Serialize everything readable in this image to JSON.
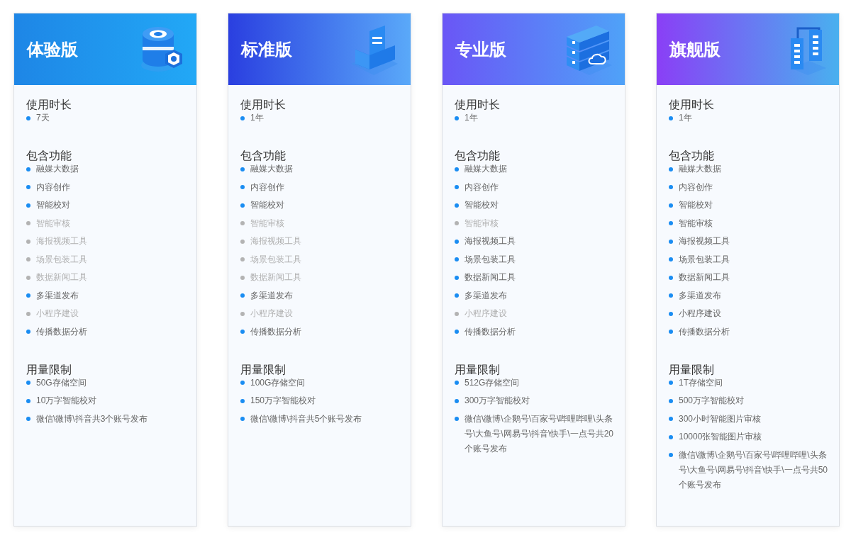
{
  "plans": [
    {
      "title": "体验版",
      "sections": [
        {
          "title": "使用时长",
          "items": [
            {
              "text": "7天",
              "included": true
            }
          ]
        },
        {
          "title": "包含功能",
          "items": [
            {
              "text": "融媒大数据",
              "included": true
            },
            {
              "text": "内容创作",
              "included": true
            },
            {
              "text": "智能校对",
              "included": true
            },
            {
              "text": "智能审核",
              "included": false
            },
            {
              "text": "海报视频工具",
              "included": false
            },
            {
              "text": "场景包装工具",
              "included": false
            },
            {
              "text": "数据新闻工具",
              "included": false
            },
            {
              "text": "多渠道发布",
              "included": true
            },
            {
              "text": "小程序建设",
              "included": false
            },
            {
              "text": "传播数据分析",
              "included": true
            }
          ]
        },
        {
          "title": "用量限制",
          "items": [
            {
              "text": "50G存储空间",
              "included": true
            },
            {
              "text": "10万字智能校对",
              "included": true
            },
            {
              "text": "微信\\微博\\抖音共3个账号发布",
              "included": true
            }
          ]
        }
      ]
    },
    {
      "title": "标准版",
      "sections": [
        {
          "title": "使用时长",
          "items": [
            {
              "text": "1年",
              "included": true
            }
          ]
        },
        {
          "title": "包含功能",
          "items": [
            {
              "text": "融媒大数据",
              "included": true
            },
            {
              "text": "内容创作",
              "included": true
            },
            {
              "text": "智能校对",
              "included": true
            },
            {
              "text": "智能审核",
              "included": false
            },
            {
              "text": "海报视频工具",
              "included": false
            },
            {
              "text": "场景包装工具",
              "included": false
            },
            {
              "text": "数据新闻工具",
              "included": false
            },
            {
              "text": "多渠道发布",
              "included": true
            },
            {
              "text": "小程序建设",
              "included": false
            },
            {
              "text": "传播数据分析",
              "included": true
            }
          ]
        },
        {
          "title": "用量限制",
          "items": [
            {
              "text": "100G存储空间",
              "included": true
            },
            {
              "text": "150万字智能校对",
              "included": true
            },
            {
              "text": "微信\\微博\\抖音共5个账号发布",
              "included": true
            }
          ]
        }
      ]
    },
    {
      "title": "专业版",
      "sections": [
        {
          "title": "使用时长",
          "items": [
            {
              "text": "1年",
              "included": true
            }
          ]
        },
        {
          "title": "包含功能",
          "items": [
            {
              "text": "融媒大数据",
              "included": true
            },
            {
              "text": "内容创作",
              "included": true
            },
            {
              "text": "智能校对",
              "included": true
            },
            {
              "text": "智能审核",
              "included": false
            },
            {
              "text": "海报视频工具",
              "included": true
            },
            {
              "text": "场景包装工具",
              "included": true
            },
            {
              "text": "数据新闻工具",
              "included": true
            },
            {
              "text": "多渠道发布",
              "included": true
            },
            {
              "text": "小程序建设",
              "included": false
            },
            {
              "text": "传播数据分析",
              "included": true
            }
          ]
        },
        {
          "title": "用量限制",
          "items": [
            {
              "text": "512G存储空间",
              "included": true
            },
            {
              "text": "300万字智能校对",
              "included": true
            },
            {
              "text": "微信\\微博\\企鹅号\\百家号\\哔哩哔哩\\头条号\\大鱼号\\网易号\\抖音\\快手\\一点号共20个账号发布",
              "included": true
            }
          ]
        }
      ]
    },
    {
      "title": "旗舰版",
      "sections": [
        {
          "title": "使用时长",
          "items": [
            {
              "text": "1年",
              "included": true
            }
          ]
        },
        {
          "title": "包含功能",
          "items": [
            {
              "text": "融媒大数据",
              "included": true
            },
            {
              "text": "内容创作",
              "included": true
            },
            {
              "text": "智能校对",
              "included": true
            },
            {
              "text": "智能审核",
              "included": true
            },
            {
              "text": "海报视频工具",
              "included": true
            },
            {
              "text": "场景包装工具",
              "included": true
            },
            {
              "text": "数据新闻工具",
              "included": true
            },
            {
              "text": "多渠道发布",
              "included": true
            },
            {
              "text": "小程序建设",
              "included": true
            },
            {
              "text": "传播数据分析",
              "included": true
            }
          ]
        },
        {
          "title": "用量限制",
          "items": [
            {
              "text": "1T存储空间",
              "included": true
            },
            {
              "text": "500万字智能校对",
              "included": true
            },
            {
              "text": "300小时智能图片审核",
              "included": true
            },
            {
              "text": "10000张智能图片审核",
              "included": true
            },
            {
              "text": "微信\\微博\\企鹅号\\百家号\\哔哩哔哩\\头条号\\大鱼号\\网易号\\抖音\\快手\\一点号共50个账号发布",
              "included": true
            }
          ]
        }
      ]
    }
  ]
}
